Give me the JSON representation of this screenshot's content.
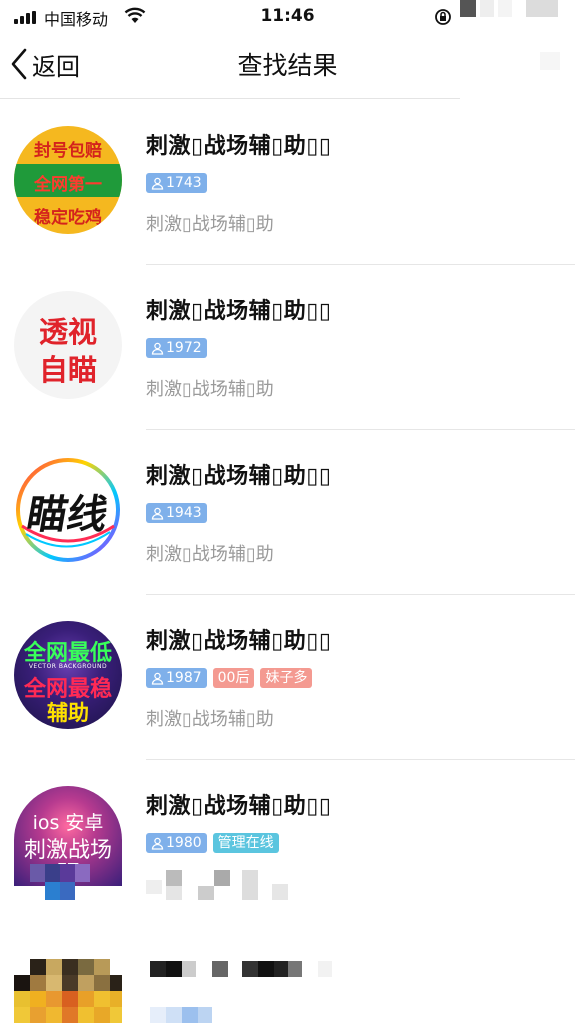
{
  "status_bar": {
    "carrier": "中国移动",
    "time": "11:46"
  },
  "nav": {
    "back_label": "返回",
    "title": "查找结果"
  },
  "results": [
    {
      "title": "刺激▯战场辅▯助▯▯",
      "member_count": "1743",
      "tags": [],
      "subtitle": "刺激▯战场辅▯助",
      "avatar_text": [
        "封号包赔",
        "全网第一",
        "稳定吃鸡"
      ]
    },
    {
      "title": "刺激▯战场辅▯助▯▯",
      "member_count": "1972",
      "tags": [],
      "subtitle": "刺激▯战场辅▯助",
      "avatar_text": [
        "透视",
        "自瞄"
      ]
    },
    {
      "title": "刺激▯战场辅▯助▯▯",
      "member_count": "1943",
      "tags": [],
      "subtitle": "刺激▯战场辅▯助",
      "avatar_text": [
        "瞄线"
      ]
    },
    {
      "title": "刺激▯战场辅▯助▯▯",
      "member_count": "1987",
      "tags": [
        "00后",
        "妹子多"
      ],
      "subtitle": "刺激▯战场辅▯助",
      "avatar_text": [
        "全网最低",
        "VECTOR BACKGROUND",
        "全网最稳",
        "辅助"
      ]
    },
    {
      "title": "刺激▯战场辅▯助▯▯",
      "member_count": "1980",
      "tags": [
        "管理在线"
      ],
      "subtitle": "",
      "avatar_text": [
        "ios 安卓",
        "刺激战场",
        "FZ"
      ]
    }
  ],
  "colors": {
    "tag_count": "#7fb0ea",
    "tag_red": "#f49a91",
    "tag_admin": "#5bc5df",
    "subtitle_gray": "#9a9a9a"
  },
  "icons": {
    "back": "chevron-left-icon",
    "member": "person-icon",
    "wifi": "wifi-icon",
    "rotation_lock": "rotation-lock-icon"
  }
}
